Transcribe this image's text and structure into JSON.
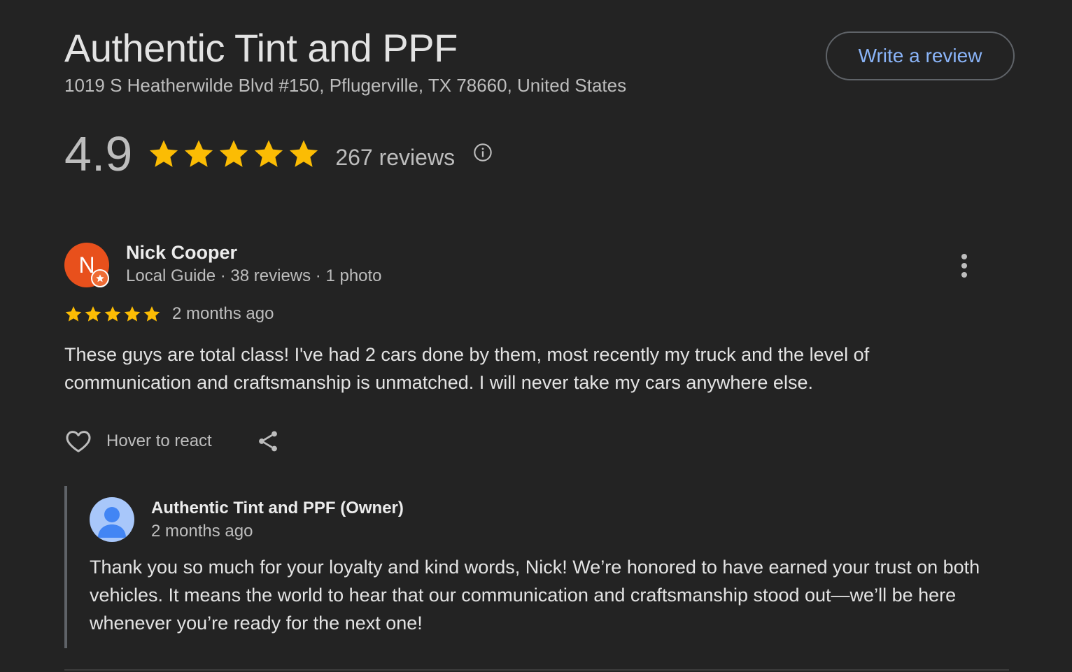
{
  "business": {
    "name": "Authentic Tint and PPF",
    "address": "1019 S Heatherwilde Blvd #150, Pflugerville, TX 78660, United States",
    "write_review_label": "Write a review"
  },
  "rating": {
    "value": "4.9",
    "stars": 5,
    "review_count_label": "267 reviews",
    "info_icon": "info-icon"
  },
  "review": {
    "avatar_initial": "N",
    "reviewer_name": "Nick Cooper",
    "reviewer_meta": "Local Guide · 38 reviews · 1 photo",
    "stars": 5,
    "time_ago": "2 months ago",
    "text": "These guys are total class! I've had 2 cars done by them, most recently my truck and the level of communication and craftsmanship is unmatched. I will never take my cars anywhere else.",
    "react_label": "Hover to react"
  },
  "owner_reply": {
    "name": "Authentic Tint and PPF (Owner)",
    "time_ago": "2 months ago",
    "text": "Thank you so much for your loyalty and kind words, Nick! We’re honored to have earned your trust on both vehicles. It means the world to hear that our communication and craftsmanship stood out—we’ll be here whenever you’re ready for the next one!"
  },
  "colors": {
    "background": "#232323",
    "star": "#fbbc04",
    "link": "#8ab4f8",
    "avatar": "#e8501c",
    "owner_avatar": "#a8c7fa"
  }
}
